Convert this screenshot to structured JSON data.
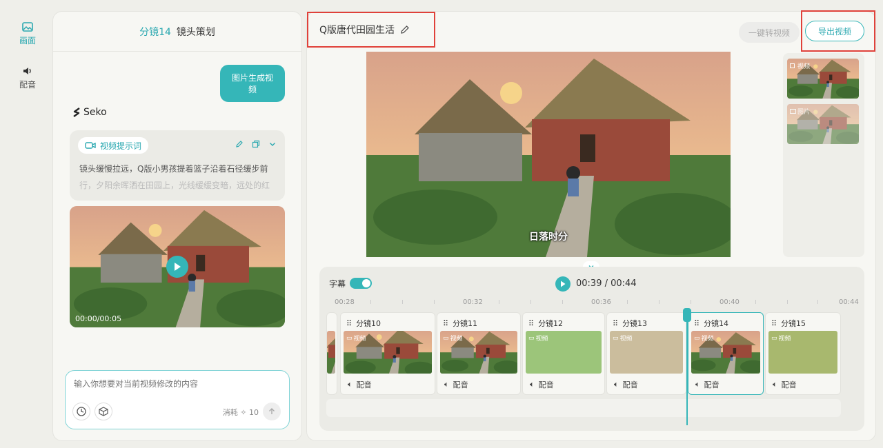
{
  "rail": {
    "items": [
      {
        "label": "画面",
        "icon": "image-icon",
        "active": true
      },
      {
        "label": "配音",
        "icon": "speaker-icon",
        "active": false
      }
    ]
  },
  "chat": {
    "shot_label": "分镜14",
    "header_title": "镜头策划",
    "user_bubble": "图片生成视频",
    "brand": "Seko",
    "prompt_chip": "视频提示词",
    "prompt_text_line1": "镜头缓慢拉远，Q版小男孩提着篮子沿着石径缓步前",
    "prompt_text_line2": "行，夕阳余晖洒在田园上，光线缓缓变暗，远处的红",
    "video_time": "00:00/00:05",
    "input_placeholder": "输入你想要对当前视频修改的内容",
    "cost_label": "消耗",
    "cost_value": "10"
  },
  "main": {
    "project_title": "Q版唐代田园生活",
    "convert_button": "一键转视频",
    "export_button": "导出视频",
    "subtitle_text": "日落时分",
    "side_thumbs": [
      {
        "tag": "视频"
      },
      {
        "tag": "图片"
      }
    ]
  },
  "timeline": {
    "subtitle_label": "字幕",
    "current_time": "00:39",
    "total_time": "00:44",
    "time_separator": " / ",
    "ticks": [
      "00:28",
      "00:32",
      "00:36",
      "00:40",
      "00:44"
    ],
    "clips": [
      {
        "name": "分镜10",
        "tag": "视频",
        "audio": "配音",
        "active": false
      },
      {
        "name": "分镜11",
        "tag": "视频",
        "audio": "配音",
        "active": false
      },
      {
        "name": "分镜12",
        "tag": "视频",
        "audio": "配音",
        "active": false
      },
      {
        "name": "分镜13",
        "tag": "视频",
        "audio": "配音",
        "active": false
      },
      {
        "name": "分镜14",
        "tag": "视频",
        "audio": "配音",
        "active": true
      },
      {
        "name": "分镜15",
        "tag": "视频",
        "audio": "配音",
        "active": false
      }
    ]
  },
  "colors": {
    "accent": "#35b6b8",
    "highlight_box": "#e0413a"
  }
}
